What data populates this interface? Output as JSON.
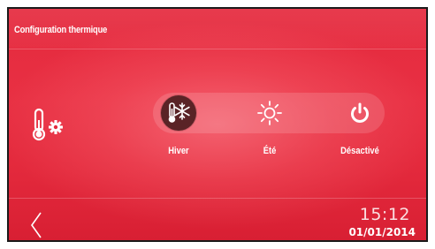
{
  "header": {
    "title": "Configuration thermique"
  },
  "modes": [
    {
      "id": "hiver",
      "label": "Hiver",
      "icon": "snowflake-thermometer-icon",
      "selected": true
    },
    {
      "id": "ete",
      "label": "Été",
      "icon": "sun-icon",
      "selected": false
    },
    {
      "id": "off",
      "label": "Désactivé",
      "icon": "power-icon",
      "selected": false
    }
  ],
  "footer": {
    "back_icon": "chevron-left-icon",
    "time": "15:12",
    "date": "01/01/2014"
  },
  "colors": {
    "background": "#e52a3e",
    "selected_mode": "#5a2326",
    "text": "#ffffff"
  }
}
